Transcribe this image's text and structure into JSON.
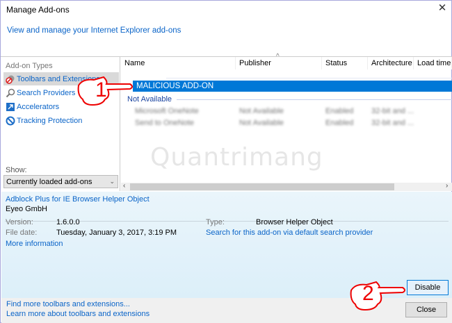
{
  "window": {
    "title": "Manage Add-ons",
    "subtitle_link": "View and manage your Internet Explorer add-ons"
  },
  "sidebar": {
    "label": "Add-on Types",
    "items": [
      {
        "label": "Toolbars and Extensions",
        "icon": "gear-blocked-icon",
        "selected": true
      },
      {
        "label": "Search Providers",
        "icon": "magnifier-icon"
      },
      {
        "label": "Accelerators",
        "icon": "accelerator-icon"
      },
      {
        "label": "Tracking Protection",
        "icon": "no-sign-icon"
      }
    ],
    "show_label": "Show:",
    "show_value": "Currently loaded add-ons"
  },
  "list": {
    "columns": [
      "Name",
      "Publisher",
      "Status",
      "Architecture",
      "Load time"
    ],
    "selected_row": "MALICIOUS ADD-ON",
    "group": "Not Available",
    "rows": [
      {
        "name": "Microsoft OneNote",
        "publisher": "Not Available",
        "status": "Enabled",
        "arch": "32-bit and ..."
      },
      {
        "name": "Send to OneNote",
        "publisher": "Not Available",
        "status": "Enabled",
        "arch": "32-bit and ..."
      }
    ]
  },
  "watermark": "Quantrimang",
  "details": {
    "name": "Adblock Plus for IE Browser Helper Object",
    "company": "Eyeo GmbH",
    "version_label": "Version:",
    "version": "1.6.0.0",
    "filedate_label": "File date:",
    "filedate": "Tuesday, January 3, 2017, 3:19 PM",
    "more_info": "More information",
    "type_label": "Type:",
    "type": "Browser Helper Object",
    "search_link": "Search for this add-on via default search provider",
    "disable": "Disable"
  },
  "footer": {
    "find_more": "Find more toolbars and extensions...",
    "learn_more": "Learn more about toolbars and extensions",
    "close": "Close"
  },
  "annotations": [
    "1",
    "2"
  ],
  "colors": {
    "accent": "#0078d7",
    "link": "#0a64c8",
    "annotation": "#e00000"
  }
}
